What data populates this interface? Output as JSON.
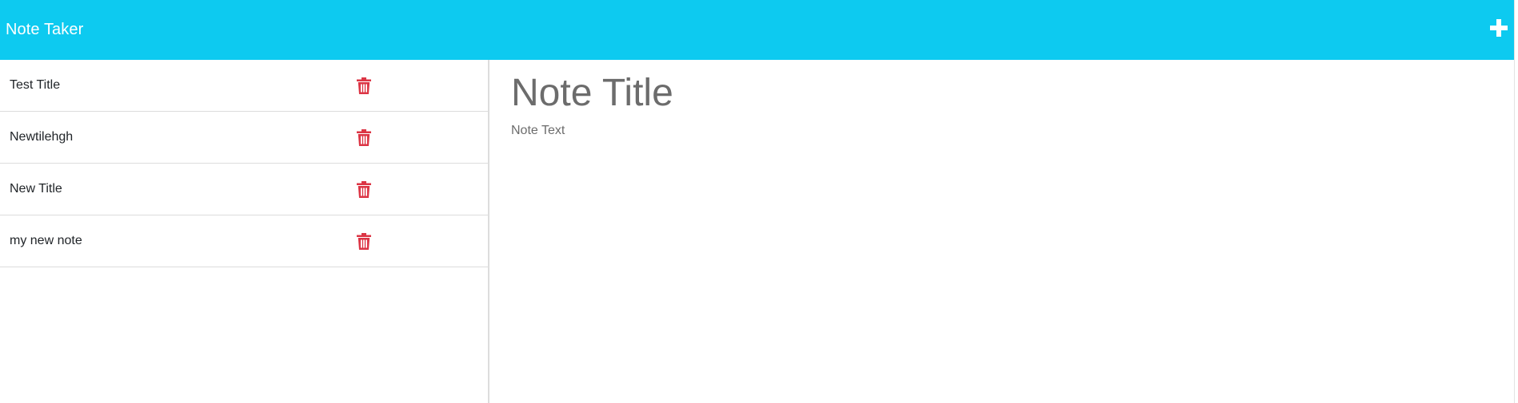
{
  "navbar": {
    "title": "Note Taker",
    "add_icon": "plus-icon",
    "background_color": "#0dcaf0"
  },
  "sidebar": {
    "delete_icon": "trash-icon",
    "delete_color": "#dc3545",
    "notes": [
      {
        "title": "Test Title"
      },
      {
        "title": "Newtilehgh"
      },
      {
        "title": "New Title"
      },
      {
        "title": "my new note"
      }
    ]
  },
  "editor": {
    "title_placeholder": "Note Title",
    "text_placeholder": "Note Text"
  }
}
